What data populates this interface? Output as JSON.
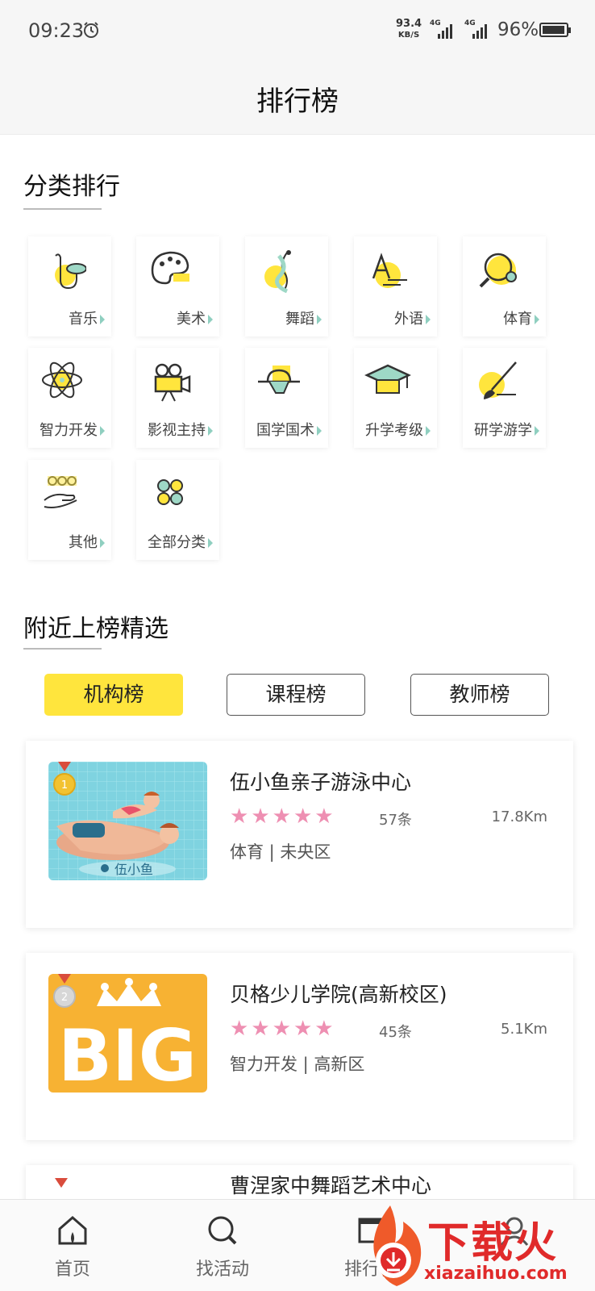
{
  "status_bar": {
    "time": "09:23",
    "net_speed": "93.4",
    "net_unit": "KB/S",
    "signal_1": "4G",
    "signal_2": "4G",
    "battery": "96%"
  },
  "header": {
    "title": "排行榜"
  },
  "categories_section": {
    "title": "分类排行",
    "items": [
      {
        "label": "音乐",
        "icon": "saxophone-icon"
      },
      {
        "label": "美术",
        "icon": "palette-icon"
      },
      {
        "label": "舞蹈",
        "icon": "dancer-icon"
      },
      {
        "label": "外语",
        "icon": "letter-a-icon"
      },
      {
        "label": "体育",
        "icon": "ping-pong-icon"
      },
      {
        "label": "智力开发",
        "icon": "atom-icon"
      },
      {
        "label": "影视主持",
        "icon": "movie-camera-icon"
      },
      {
        "label": "国学国术",
        "icon": "scholar-hat-icon"
      },
      {
        "label": "升学考级",
        "icon": "graduation-cap-icon"
      },
      {
        "label": "研学游学",
        "icon": "brush-icon"
      },
      {
        "label": "其他",
        "icon": "hand-dots-icon"
      },
      {
        "label": "全部分类",
        "icon": "clover-icon"
      }
    ]
  },
  "nearby_section": {
    "title": "附近上榜精选",
    "tabs": [
      {
        "label": "机构榜",
        "active": true
      },
      {
        "label": "课程榜",
        "active": false
      },
      {
        "label": "教师榜",
        "active": false
      }
    ],
    "list": [
      {
        "name": "伍小鱼亲子游泳中心",
        "rating": 5,
        "count": "57条",
        "distance": "17.8Km",
        "meta": "体育 | 未央区",
        "thumb_text": "伍小鱼",
        "medal": "1"
      },
      {
        "name": "贝格少儿学院(高新校区)",
        "rating": 5,
        "count": "45条",
        "distance": "5.1Km",
        "meta": "智力开发 | 高新区",
        "thumb_text": "BIG",
        "medal": "2"
      },
      {
        "name": "曹涅家中舞蹈艺术中心"
      }
    ]
  },
  "bottom_nav": [
    {
      "label": "首页",
      "icon": "home-icon"
    },
    {
      "label": "找活动",
      "icon": "search-icon"
    },
    {
      "label": "排行榜",
      "icon": "ranking-icon"
    },
    {
      "label": "",
      "icon": "profile-icon"
    }
  ],
  "watermark": {
    "text": "下载火",
    "url": "xiazaihuo.com"
  },
  "colors": {
    "accent": "#ffe53d",
    "star": "#ee8fb2",
    "arrow": "#8fcfc0",
    "watermark": "#e02a2a"
  }
}
